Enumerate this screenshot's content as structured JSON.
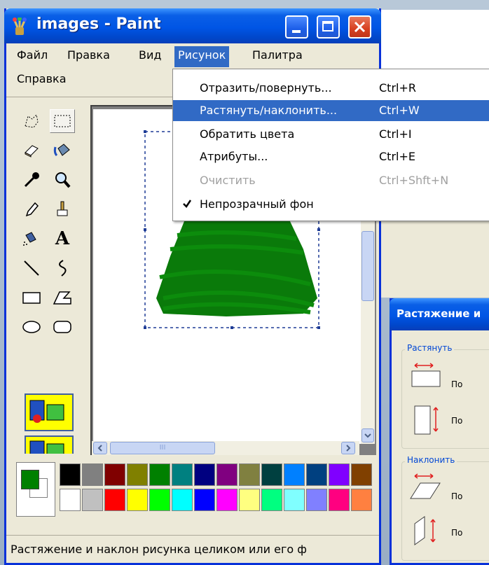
{
  "window": {
    "title": "images - Paint"
  },
  "menubar": {
    "items": [
      "Файл",
      "Правка",
      "Вид",
      "Рисунок",
      "Палитра"
    ],
    "active": "Рисунок",
    "second_row": "Справка"
  },
  "image_menu": {
    "items": [
      {
        "label": "Отразить/повернуть...",
        "shortcut": "Ctrl+R"
      },
      {
        "label": "Растянуть/наклонить...",
        "shortcut": "Ctrl+W",
        "highlighted": true
      },
      {
        "label": "Обратить цвета",
        "shortcut": "Ctrl+I"
      },
      {
        "label": "Атрибуты...",
        "shortcut": "Ctrl+E"
      },
      {
        "label": "Очистить",
        "shortcut": "Ctrl+Shft+N",
        "disabled": true
      },
      {
        "label": "Непрозрачный фон",
        "checked": true
      }
    ]
  },
  "toolbox": {
    "tools": [
      "free-select-icon",
      "rect-select-icon",
      "eraser-icon",
      "fill-icon",
      "color-picker-icon",
      "magnifier-icon",
      "pencil-icon",
      "brush-icon",
      "airbrush-icon",
      "text-icon",
      "line-icon",
      "curve-icon",
      "rectangle-icon",
      "polygon-icon",
      "ellipse-icon",
      "rounded-rect-icon"
    ],
    "text_tool_glyph": "A"
  },
  "palette": {
    "foreground": "#008000",
    "background": "#ffffff",
    "row1": [
      "#000000",
      "#808080",
      "#800000",
      "#808000",
      "#008000",
      "#008080",
      "#000080",
      "#800080",
      "#808040",
      "#004040",
      "#0080ff",
      "#004080",
      "#8000ff",
      "#804000"
    ],
    "row2": [
      "#ffffff",
      "#c0c0c0",
      "#ff0000",
      "#ffff00",
      "#00ff00",
      "#00ffff",
      "#0000ff",
      "#ff00ff",
      "#ffff80",
      "#00ff80",
      "#80ffff",
      "#8080ff",
      "#ff0080",
      "#ff8040"
    ]
  },
  "status": {
    "text": "Растяжение и наклон рисунка целиком или его ф"
  },
  "dialog": {
    "title": "Растяжение и",
    "groups": [
      {
        "label": "Растянуть",
        "options": [
          "По",
          "По"
        ]
      },
      {
        "label": "Наклонить",
        "options": [
          "По",
          "По"
        ]
      }
    ]
  },
  "scroll": {
    "hscroll_grip": "III"
  }
}
